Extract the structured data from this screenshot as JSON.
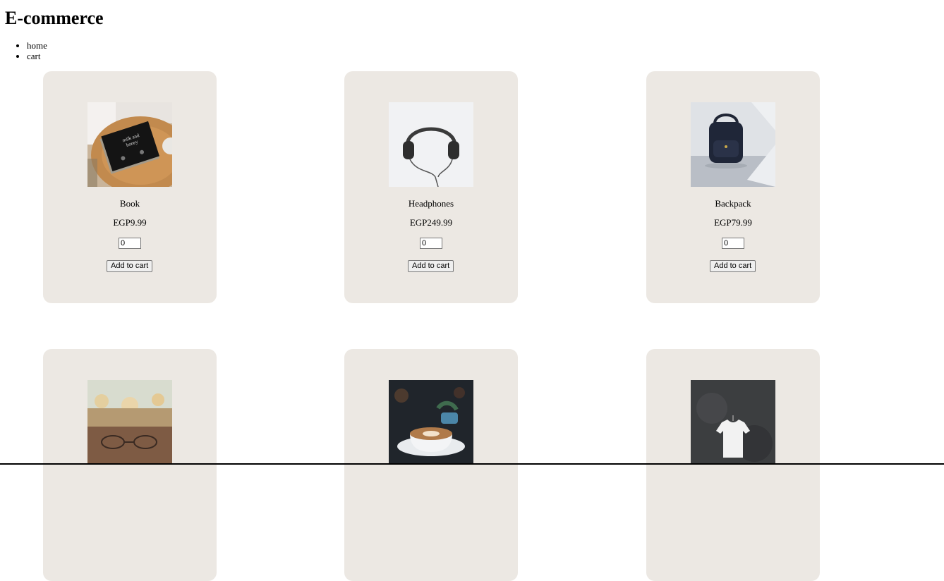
{
  "header": {
    "title": "E-commerce"
  },
  "nav": {
    "items": [
      {
        "label": "home"
      },
      {
        "label": "cart"
      }
    ]
  },
  "products": [
    {
      "name": "Book",
      "price": "EGP9.99",
      "quantity": "0",
      "button": "Add to cart",
      "image": "book-image"
    },
    {
      "name": "Headphones",
      "price": "EGP249.99",
      "quantity": "0",
      "button": "Add to cart",
      "image": "headphones-image"
    },
    {
      "name": "Backpack",
      "price": "EGP79.99",
      "quantity": "0",
      "button": "Add to cart",
      "image": "backpack-image"
    },
    {
      "image": "glasses-image"
    },
    {
      "image": "coffee-image"
    },
    {
      "image": "tshirt-image"
    }
  ],
  "colors": {
    "card_background": "#ece8e3",
    "page_background": "#ffffff"
  }
}
